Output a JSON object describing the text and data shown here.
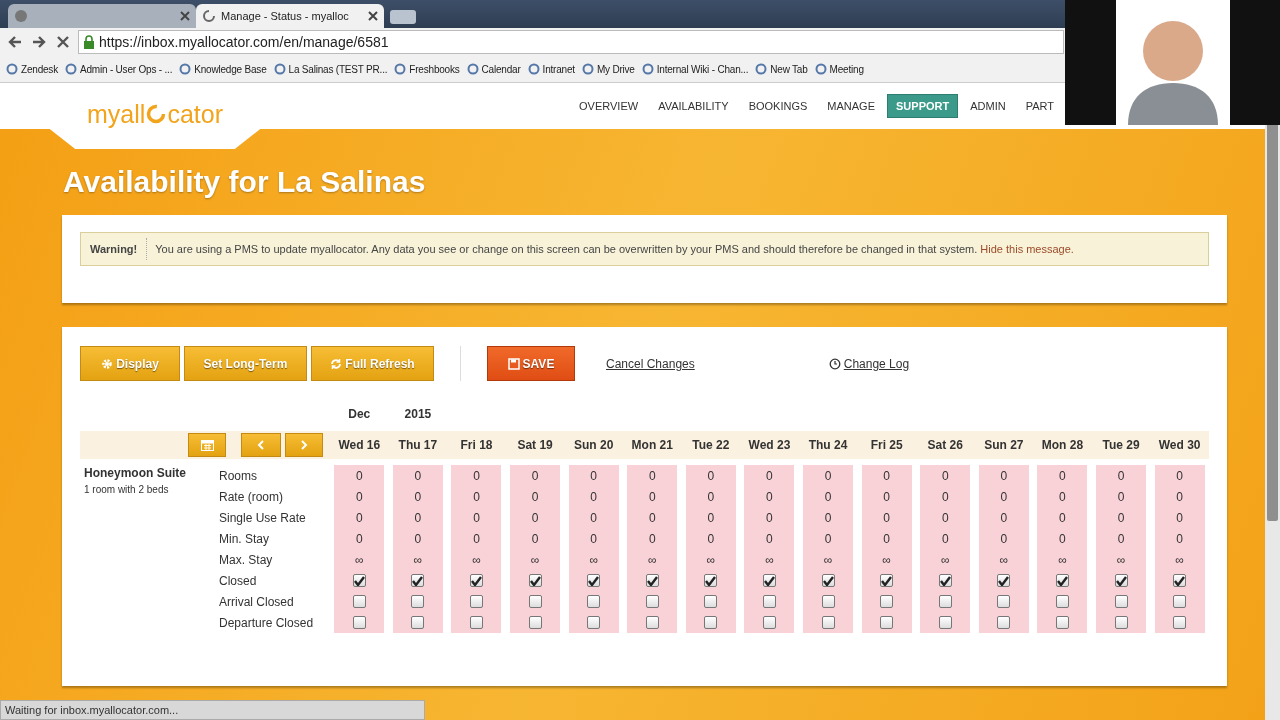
{
  "browser": {
    "tabs": [
      {
        "selected": false
      },
      {
        "title": "Manage - Status - myalloc",
        "selected": true
      }
    ],
    "url": "https://inbox.myallocator.com/en/manage/6581",
    "bookmarks": [
      "Zendesk",
      "Admin - User Ops - ...",
      "Knowledge Base",
      "La Salinas (TEST PR...",
      "Freshbooks",
      "Calendar",
      "Intranet",
      "My Drive",
      "Internal Wiki - Chan...",
      "New Tab",
      "Meeting"
    ],
    "status_text": "Waiting for inbox.myallocator.com..."
  },
  "site": {
    "logo": {
      "part_1": "myall",
      "part_2": "cator"
    },
    "nav": [
      {
        "label": "OVERVIEW",
        "selected": false
      },
      {
        "label": "AVAILABILITY",
        "selected": false
      },
      {
        "label": "BOOKINGS",
        "selected": false
      },
      {
        "label": "MANAGE",
        "selected": false
      },
      {
        "label": "SUPPORT",
        "selected": true
      },
      {
        "label": "ADMIN",
        "selected": false
      },
      {
        "label": "PART",
        "selected": false
      }
    ]
  },
  "page_title": "Availability for La Salinas",
  "warning": {
    "label": "Warning!",
    "message": "You are using a PMS to update myallocator. Any data you see or change on this screen can be overwritten by your PMS and should therefore be changed in that system.",
    "link": "Hide this message."
  },
  "toolbar": [
    {
      "kind": "button",
      "label": "Display"
    },
    {
      "kind": "button",
      "label": "Set Long-Term"
    },
    {
      "kind": "button",
      "label": "Full Refresh"
    },
    {
      "kind": "primary",
      "label": "SAVE"
    },
    {
      "kind": "link",
      "label": "Cancel Changes"
    },
    {
      "kind": "link",
      "label": "Change Log"
    }
  ],
  "grid": {
    "month": "Dec",
    "year": "2015",
    "room": {
      "name": "Honeymoon Suite",
      "description": "1 room with 2 beds"
    },
    "rows": [
      {
        "label": "Rooms",
        "kind": "text"
      },
      {
        "label": "Rate (room)",
        "kind": "text"
      },
      {
        "label": "Single Use Rate",
        "kind": "text"
      },
      {
        "label": "Min. Stay",
        "kind": "text"
      },
      {
        "label": "Max. Stay",
        "kind": "text"
      },
      {
        "label": "Closed",
        "kind": "checkbox"
      },
      {
        "label": "Arrival Closed",
        "kind": "checkbox"
      },
      {
        "label": "Departure Closed",
        "kind": "checkbox"
      }
    ],
    "days": [
      {
        "label": "Wed 16",
        "cells": [
          {
            "text": "0"
          },
          {
            "text": "0"
          },
          {
            "text": "0"
          },
          {
            "text": "0"
          },
          {
            "text": "∞"
          },
          {
            "checked": true
          },
          {
            "checked": false
          },
          {
            "checked": false
          }
        ]
      },
      {
        "label": "Thu 17",
        "cells": [
          {
            "text": "0"
          },
          {
            "text": "0"
          },
          {
            "text": "0"
          },
          {
            "text": "0"
          },
          {
            "text": "∞"
          },
          {
            "checked": true
          },
          {
            "checked": false
          },
          {
            "checked": false
          }
        ]
      },
      {
        "label": "Fri 18",
        "cells": [
          {
            "text": "0"
          },
          {
            "text": "0"
          },
          {
            "text": "0"
          },
          {
            "text": "0"
          },
          {
            "text": "∞"
          },
          {
            "checked": true
          },
          {
            "checked": false
          },
          {
            "checked": false
          }
        ]
      },
      {
        "label": "Sat 19",
        "cells": [
          {
            "text": "0"
          },
          {
            "text": "0"
          },
          {
            "text": "0"
          },
          {
            "text": "0"
          },
          {
            "text": "∞"
          },
          {
            "checked": true
          },
          {
            "checked": false
          },
          {
            "checked": false
          }
        ]
      },
      {
        "label": "Sun 20",
        "cells": [
          {
            "text": "0"
          },
          {
            "text": "0"
          },
          {
            "text": "0"
          },
          {
            "text": "0"
          },
          {
            "text": "∞"
          },
          {
            "checked": true
          },
          {
            "checked": false
          },
          {
            "checked": false
          }
        ]
      },
      {
        "label": "Mon 21",
        "cells": [
          {
            "text": "0"
          },
          {
            "text": "0"
          },
          {
            "text": "0"
          },
          {
            "text": "0"
          },
          {
            "text": "∞"
          },
          {
            "checked": true
          },
          {
            "checked": false
          },
          {
            "checked": false
          }
        ]
      },
      {
        "label": "Tue 22",
        "cells": [
          {
            "text": "0"
          },
          {
            "text": "0"
          },
          {
            "text": "0"
          },
          {
            "text": "0"
          },
          {
            "text": "∞"
          },
          {
            "checked": true
          },
          {
            "checked": false
          },
          {
            "checked": false
          }
        ]
      },
      {
        "label": "Wed 23",
        "cells": [
          {
            "text": "0"
          },
          {
            "text": "0"
          },
          {
            "text": "0"
          },
          {
            "text": "0"
          },
          {
            "text": "∞"
          },
          {
            "checked": true
          },
          {
            "checked": false
          },
          {
            "checked": false
          }
        ]
      },
      {
        "label": "Thu 24",
        "cells": [
          {
            "text": "0"
          },
          {
            "text": "0"
          },
          {
            "text": "0"
          },
          {
            "text": "0"
          },
          {
            "text": "∞"
          },
          {
            "checked": true
          },
          {
            "checked": false
          },
          {
            "checked": false
          }
        ]
      },
      {
        "label": "Fri 25",
        "cells": [
          {
            "text": "0"
          },
          {
            "text": "0"
          },
          {
            "text": "0"
          },
          {
            "text": "0"
          },
          {
            "text": "∞"
          },
          {
            "checked": true
          },
          {
            "checked": false
          },
          {
            "checked": false
          }
        ]
      },
      {
        "label": "Sat 26",
        "cells": [
          {
            "text": "0"
          },
          {
            "text": "0"
          },
          {
            "text": "0"
          },
          {
            "text": "0"
          },
          {
            "text": "∞"
          },
          {
            "checked": true
          },
          {
            "checked": false
          },
          {
            "checked": false
          }
        ]
      },
      {
        "label": "Sun 27",
        "cells": [
          {
            "text": "0"
          },
          {
            "text": "0"
          },
          {
            "text": "0"
          },
          {
            "text": "0"
          },
          {
            "text": "∞"
          },
          {
            "checked": true
          },
          {
            "checked": false
          },
          {
            "checked": false
          }
        ]
      },
      {
        "label": "Mon 28",
        "cells": [
          {
            "text": "0"
          },
          {
            "text": "0"
          },
          {
            "text": "0"
          },
          {
            "text": "0"
          },
          {
            "text": "∞"
          },
          {
            "checked": true
          },
          {
            "checked": false
          },
          {
            "checked": false
          }
        ]
      },
      {
        "label": "Tue 29",
        "cells": [
          {
            "text": "0"
          },
          {
            "text": "0"
          },
          {
            "text": "0"
          },
          {
            "text": "0"
          },
          {
            "text": "∞"
          },
          {
            "checked": true
          },
          {
            "checked": false
          },
          {
            "checked": false
          }
        ]
      },
      {
        "label": "Wed 30",
        "cells": [
          {
            "text": "0"
          },
          {
            "text": "0"
          },
          {
            "text": "0"
          },
          {
            "text": "0"
          },
          {
            "text": "∞"
          },
          {
            "checked": true
          },
          {
            "checked": false
          },
          {
            "checked": false
          }
        ]
      }
    ]
  }
}
